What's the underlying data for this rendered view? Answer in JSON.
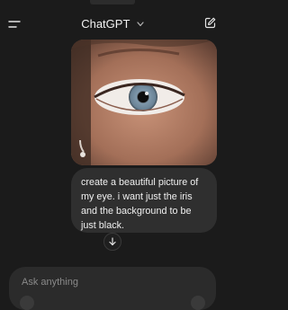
{
  "header": {
    "title": "ChatGPT",
    "menu_icon": "menu-icon",
    "title_chevron_icon": "chevron-down-icon",
    "new_chat_icon": "new-chat-icon"
  },
  "conversation": {
    "image_alt_icon": "user-uploaded-eye-photo",
    "user_message": "create a beautiful picture of my eye. i want just the iris and the background to be just black."
  },
  "scroll_button": {
    "icon": "arrow-down-icon"
  },
  "composer": {
    "placeholder": "Ask anything"
  },
  "colors": {
    "background": "#1b1b1b",
    "bubble": "#2f2f2f",
    "composer": "#2b2b2b",
    "text": "#ececec",
    "placeholder": "#8a8a8a"
  }
}
